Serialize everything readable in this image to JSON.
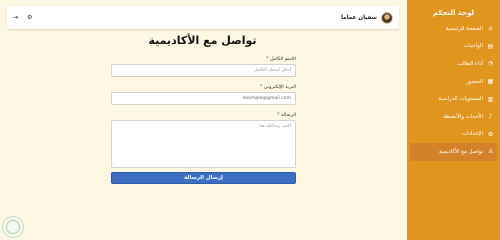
{
  "sidebar": {
    "title": "لوحة التحكم",
    "items": [
      {
        "label": "الصفحة الرئيسية",
        "icon": "home-icon",
        "glyph": "⌂"
      },
      {
        "label": "الواجبات",
        "icon": "document-icon",
        "glyph": "▤"
      },
      {
        "label": "أداء الطالب",
        "icon": "chart-icon",
        "glyph": "◔"
      },
      {
        "label": "الحضور",
        "icon": "calendar-icon",
        "glyph": "▦"
      },
      {
        "label": "المستويات الدراسية",
        "icon": "book-icon",
        "glyph": "▥"
      },
      {
        "label": "الأحداث والأنشطة",
        "icon": "bell-icon",
        "glyph": "♪"
      },
      {
        "label": "الإعدادات",
        "icon": "gear-icon",
        "glyph": "⚙"
      },
      {
        "label": "تواصل مع الأكاديمية",
        "icon": "user-icon",
        "glyph": "♙",
        "active": true
      }
    ]
  },
  "header": {
    "user_name": "سفيان عماما",
    "settings_icon": "gear-icon",
    "logout_icon": "logout-icon"
  },
  "page": {
    "title": "تواصل مع الأكاديمية"
  },
  "form": {
    "name_label": "الاسم الكامل",
    "name_placeholder": "أدخل اسمك الكامل",
    "email_label": "البريد الإلكتروني",
    "email_value": "example@gmail.com",
    "message_label": "الرسالة",
    "message_placeholder": "اكتب رسالتك هنا",
    "required_mark": "*",
    "submit_label": "إرسال الرسالة"
  },
  "colors": {
    "sidebar_bg": "#e0951f",
    "active_item_bg": "#d4822a",
    "page_bg": "#fdf8e4",
    "button_bg": "#3a6fc4"
  }
}
